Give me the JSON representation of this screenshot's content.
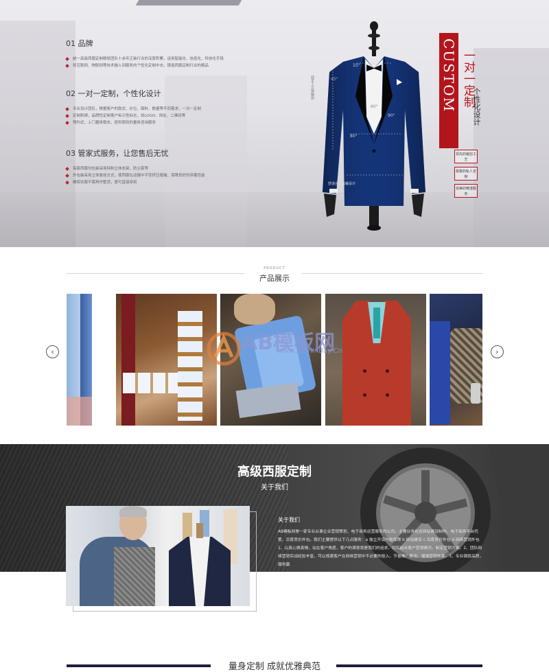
{
  "hero": {
    "features": [
      {
        "title": "01 品牌",
        "bullets": [
          "统一高级西服定制精修团队十余年正装行业的深厚积累，运用智能化、信息化、科技化手段",
          "将互联网、物联网等技术融入到服务的个性化定制中去，铸造西服定制行业的精品"
        ]
      },
      {
        "title": "02 一对一定制，个性化设计",
        "bullets": [
          "专业设计团队，根据客户的款式、价位、面料、数量等不同需求，一对一定制",
          "定制刺绣，品牌性定制客户标示性标志，如LOGO、网址、二维码等",
          "预约式，上门量体裁衣，提供周到的量体咨询服务"
        ]
      },
      {
        "title": "03 管家式服务，让您售后无忧",
        "bullets": [
          "每套西服均包装采用特制立体衣架，防尘套等",
          "外包装采用立体悬挂方式，使西服在运输中不受挤压褶皱，保障良好的穿着性能",
          "确保衣服不需再作整烫，便可直接穿用"
        ]
      }
    ],
    "custom_label": "CUSTOM",
    "slogan_1": "一对一定制",
    "slogan_2": "个性化设计",
    "tags": [
      "领先的裁剪工艺",
      "极致的私人定制",
      "完美的精湛服务"
    ],
    "suit_annotations": {
      "deg1": "45°",
      "deg2": "15°",
      "deg3": "60°",
      "deg4": "80°",
      "deg5": "90°",
      "vertical_note": "纯手工立体裁剪",
      "bottom_note": "舒适合体剪裁设计"
    }
  },
  "products": {
    "eyebrow": "PRODUCT",
    "title": "产品展示",
    "prev_icon": "chevron-left-icon",
    "next_icon": "chevron-right-icon"
  },
  "watermark": {
    "brand": "AB模板网",
    "url": "www.AdminBuy.Cn"
  },
  "about": {
    "title": "高级西服定制",
    "subtitle": "关于我们",
    "heading": "关于我们",
    "body": "AB模板网是一家专业从事企业营销策划、电子商务运营服务的公司，主要业务包含网站建设制作、电子商务平台托管、百度竞价外包。我们主要提供以下几点服务：a 独立开设内容保障 b 网站建设 c 百度竞价外包 d 网络营销外包 1、以真心换真情，站在客户角度，客户的满意就是我们的追求，切实结合客户营销情况，制定营销方案。2、团队网络营销实战经验丰富，可以规避客户在网络营销中不必要的投入。节省推广费用、增强营销效果。3、专业铸就品质，服务赢"
  },
  "footer": {
    "title": "量身定制 成就优雅典范"
  }
}
